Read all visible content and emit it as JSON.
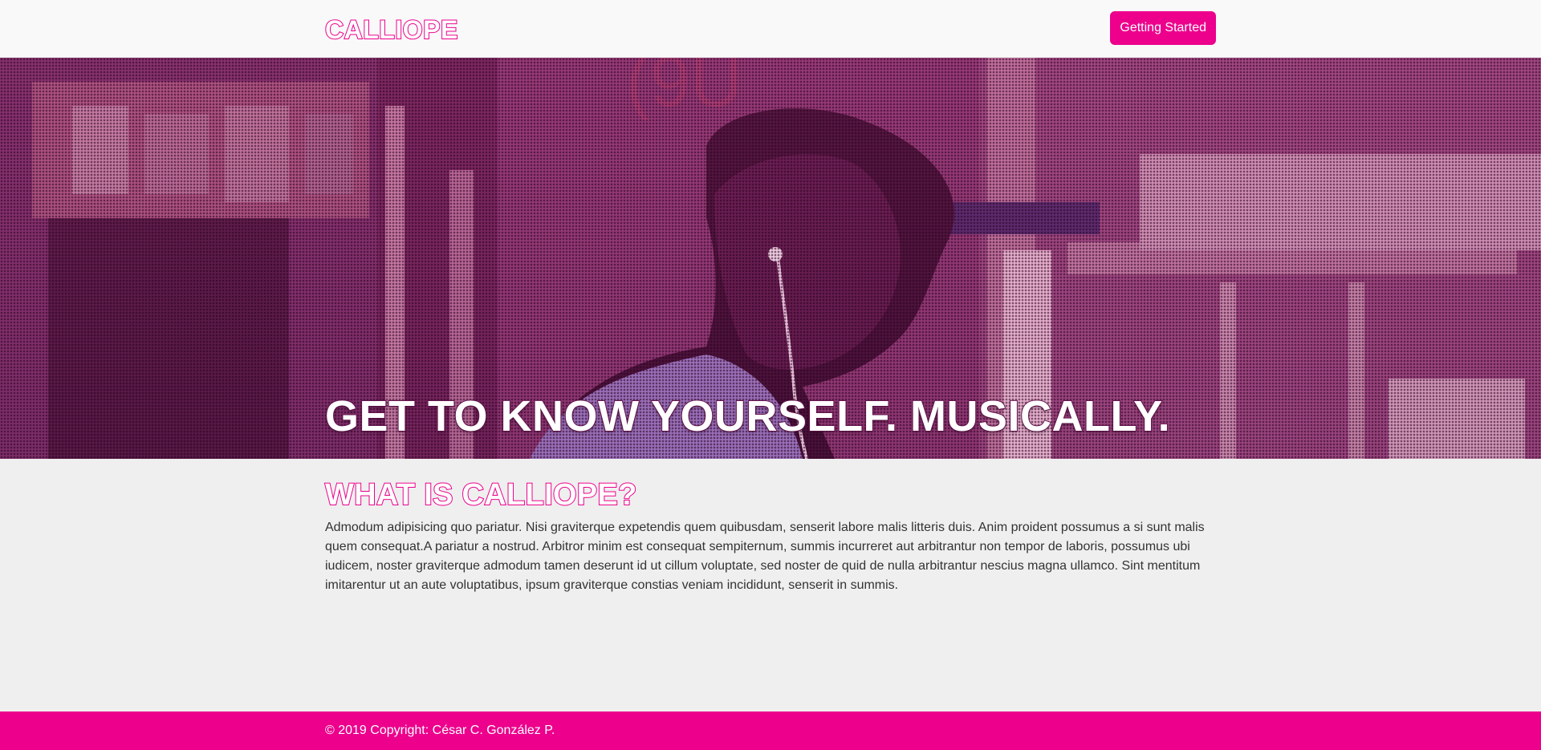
{
  "header": {
    "logo": "CALLIOPE",
    "cta_label": "Getting Started"
  },
  "hero": {
    "title": "GET TO KNOW YOURSELF. MUSICALLY.",
    "image": "photo of a man wearing earphones in a market, pink halftone treatment"
  },
  "about": {
    "title": "WHAT IS CALLIOPE?",
    "body": "Admodum adipisicing quo pariatur. Nisi graviterque expetendis quem quibusdam, senserit labore malis litteris duis. Anim proident possumus a si sunt malis quem consequat.A pariatur a nostrud. Arbitror minim est consequat sempiternum, summis incurreret aut arbitrantur non tempor de laboris, possumus ubi iudicem, noster graviterque admodum tamen deserunt id ut cillum voluptate, sed noster de quid de nulla arbitrantur nescius magna ullamco. Sint mentitum imitarentur ut an aute voluptatibus, ipsum graviterque constias veniam incididunt, senserit in summis."
  },
  "footer": {
    "copyright": "© 2019 Copyright: César C. González P."
  },
  "colors": {
    "brand": "#ec008c",
    "header_bg": "#f9f9f9",
    "page_bg": "#efefef",
    "text": "#333333"
  }
}
